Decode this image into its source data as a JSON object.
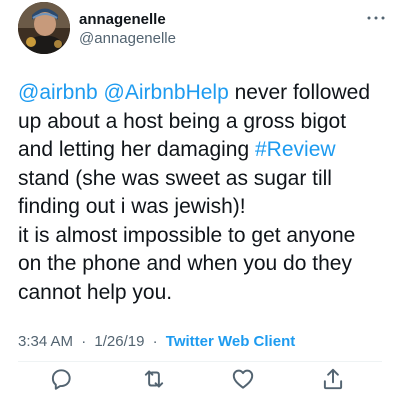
{
  "user": {
    "display_name": "annagenelle",
    "handle": "@annagenelle"
  },
  "tweet": {
    "lines": [
      [
        {
          "type": "mention",
          "text": "@airbnb"
        },
        {
          "type": "text",
          "text": " "
        },
        {
          "type": "mention",
          "text": "@AirbnbHelp"
        },
        {
          "type": "text",
          "text": " never followed"
        }
      ],
      [
        {
          "type": "text",
          "text": "up about a host being a gross bigot"
        }
      ],
      [
        {
          "type": "text",
          "text": "and letting her damaging "
        },
        {
          "type": "hashtag",
          "text": "#Review"
        }
      ],
      [
        {
          "type": "text",
          "text": "stand (she was sweet as sugar till"
        }
      ],
      [
        {
          "type": "text",
          "text": "finding out i was jewish)!"
        }
      ],
      [
        {
          "type": "text",
          "text": "it is almost impossible to get anyone"
        }
      ],
      [
        {
          "type": "text",
          "text": "on the phone and when you do they"
        }
      ],
      [
        {
          "type": "text",
          "text": "cannot help you."
        }
      ]
    ]
  },
  "meta": {
    "time": "3:34 AM",
    "separator": "·",
    "date": "1/26/19",
    "client": "Twitter Web Client"
  },
  "icons": {
    "more": "more-icon",
    "reply": "reply-icon",
    "retweet": "retweet-icon",
    "like": "like-icon",
    "share": "share-icon"
  },
  "colors": {
    "link": "#1d9bf0",
    "text": "#0f1419",
    "secondary": "#536471"
  }
}
